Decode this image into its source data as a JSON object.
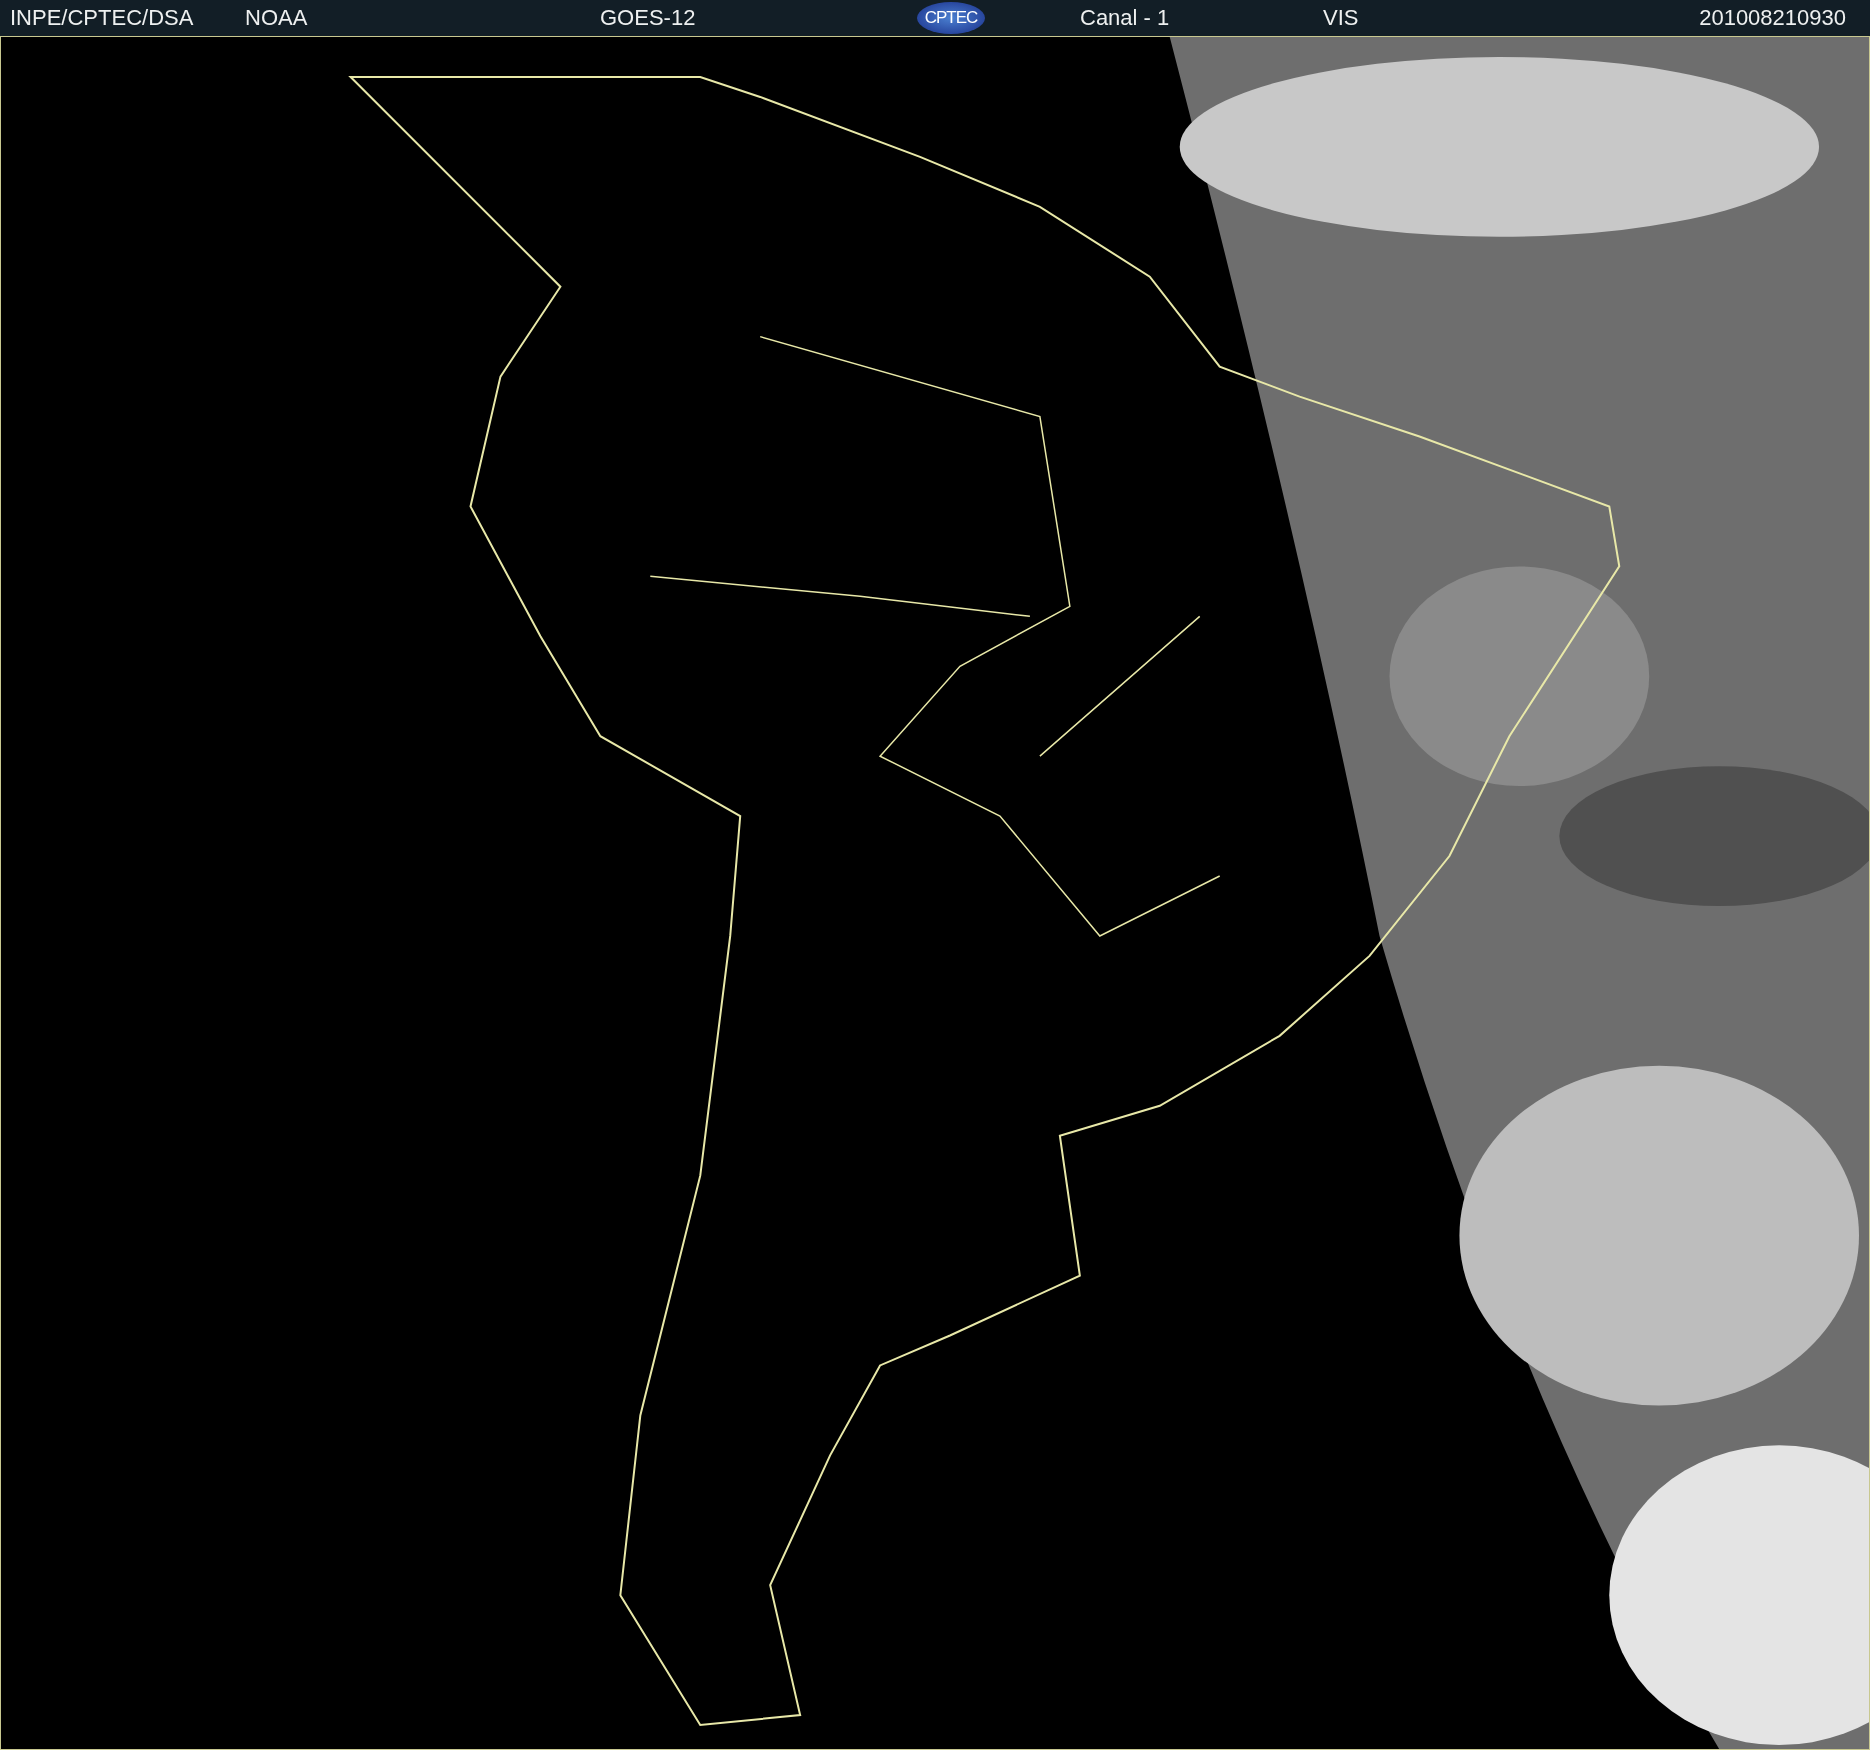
{
  "header": {
    "source": "INPE/CPTEC/DSA",
    "agency": "NOAA",
    "satellite": "GOES-12",
    "logo": "CPTEC",
    "channel": "Canal - 1",
    "band": "VIS",
    "timestamp": "201008210930"
  }
}
